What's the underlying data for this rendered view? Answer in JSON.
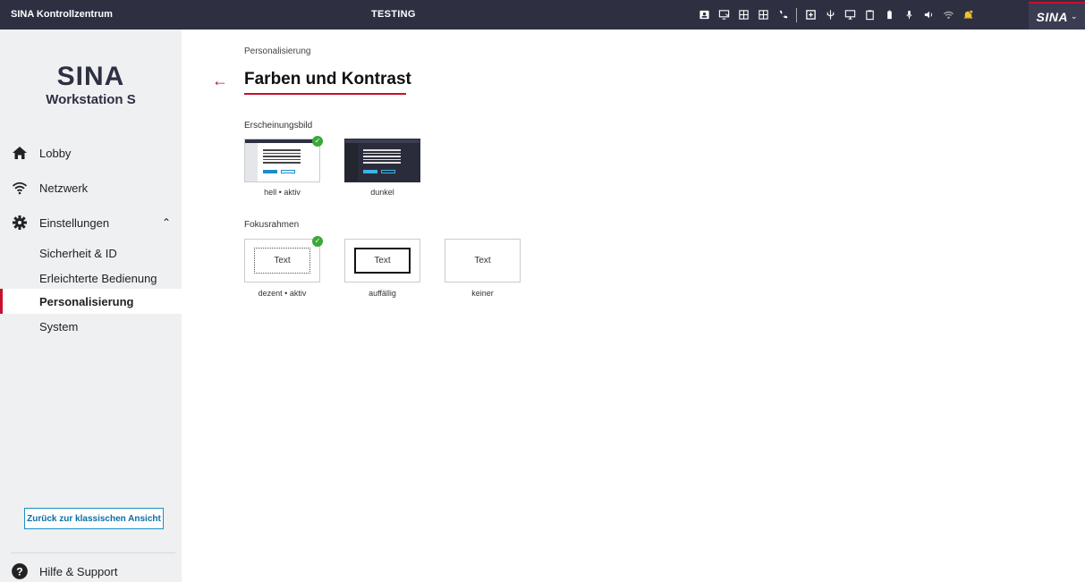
{
  "topbar": {
    "app_title": "SINA Kontrollzentrum",
    "env_label": "TESTING",
    "brand_label": "SINA",
    "icons": [
      "id-card-icon",
      "desktop-connect-icon",
      "grid-icon",
      "grid-alt-icon",
      "phone-icon",
      "window-add-icon",
      "usb-icon",
      "monitor-icon",
      "clipboard-icon",
      "battery-icon",
      "microphone-icon",
      "speaker-icon",
      "wifi-icon",
      "notification-bell-icon"
    ]
  },
  "sidebar": {
    "brand_logo": "SINA",
    "brand_product": "Workstation S",
    "items": [
      {
        "label": "Lobby",
        "icon": "home-icon"
      },
      {
        "label": "Netzwerk",
        "icon": "wifi-icon"
      },
      {
        "label": "Einstellungen",
        "icon": "gear-icon"
      }
    ],
    "sub_items": [
      {
        "label": "Sicherheit & ID",
        "active": false
      },
      {
        "label": "Erleichterte Bedienung",
        "active": false
      },
      {
        "label": "Personalisierung",
        "active": true
      },
      {
        "label": "System",
        "active": false
      }
    ],
    "classic_button": "Zurück zur klassischen Ansicht",
    "help_label": "Hilfe & Support"
  },
  "main": {
    "breadcrumb": "Personalisierung",
    "title": "Farben und Kontrast",
    "appearance": {
      "label": "Erscheinungsbild",
      "options": [
        {
          "caption": "hell • aktiv",
          "selected": true
        },
        {
          "caption": "dunkel",
          "selected": false
        }
      ]
    },
    "focus": {
      "label": "Fokusrahmen",
      "sample_text": "Text",
      "options": [
        {
          "caption": "dezent • aktiv",
          "selected": true
        },
        {
          "caption": "auffällig",
          "selected": false
        },
        {
          "caption": "keiner",
          "selected": false
        }
      ]
    }
  },
  "colors": {
    "accent": "#c8102e",
    "topbar": "#2e3042",
    "link": "#1a8fc7",
    "check": "#3aa83a"
  }
}
